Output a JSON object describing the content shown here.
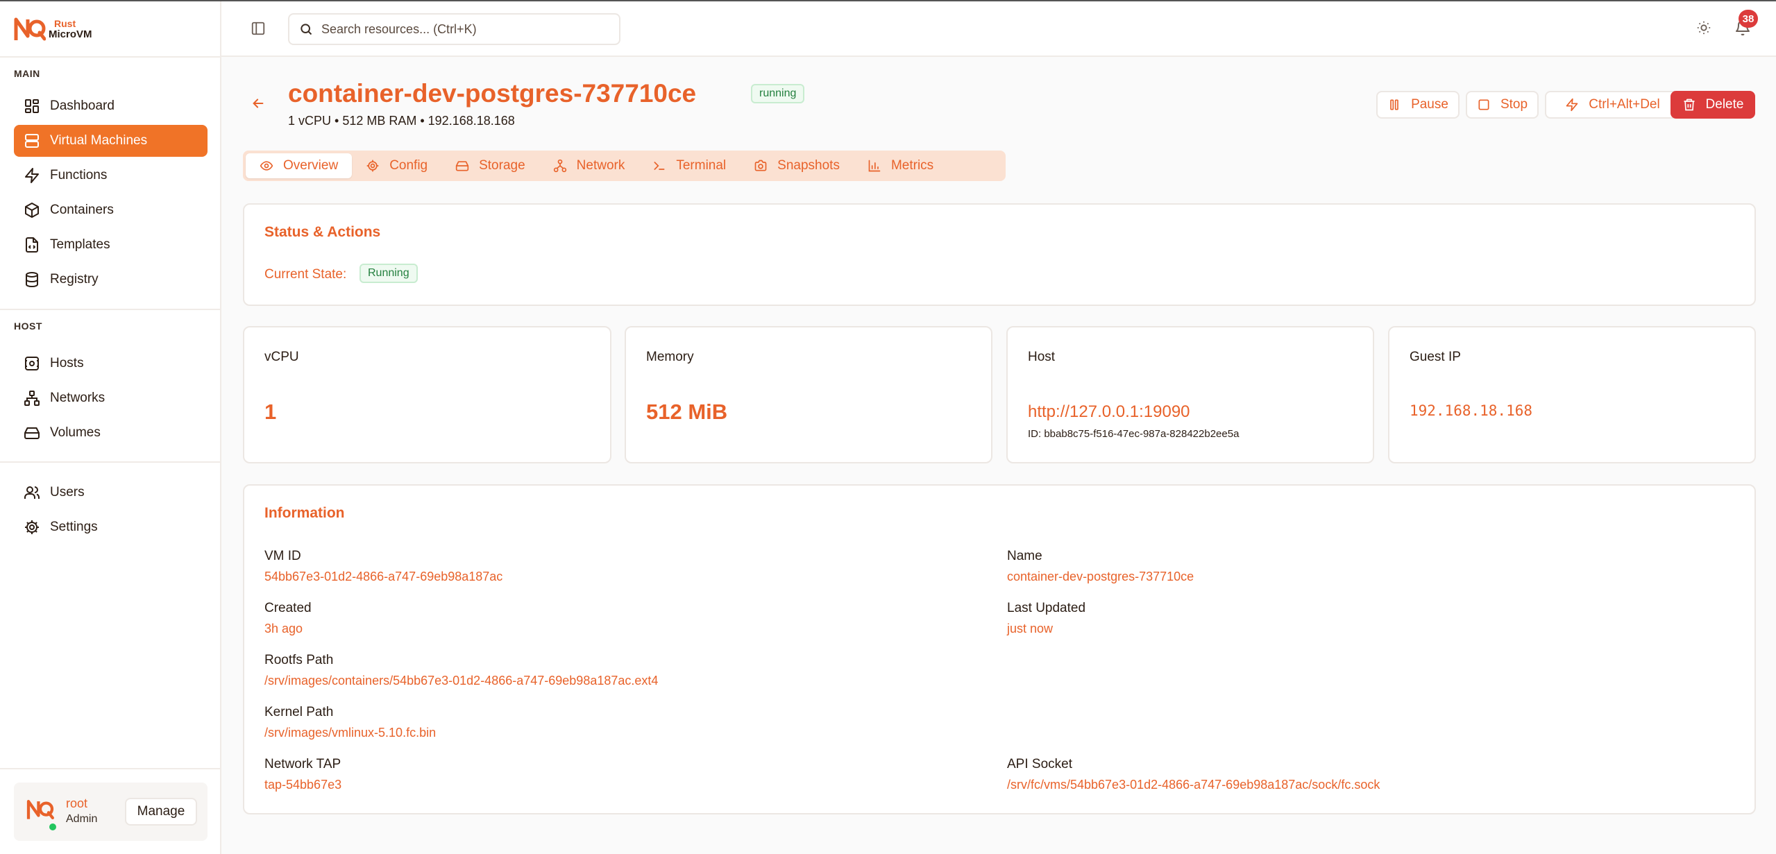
{
  "brand": {
    "line1": "Rust",
    "line2": "MicroVM",
    "logo_icon": "nq-logo-icon"
  },
  "sidebar": {
    "section_main": "MAIN",
    "section_host": "HOST",
    "main_items": [
      {
        "label": "Dashboard",
        "icon": "dashboard-icon"
      },
      {
        "label": "Virtual Machines",
        "icon": "server-icon"
      },
      {
        "label": "Functions",
        "icon": "bolt-icon"
      },
      {
        "label": "Containers",
        "icon": "box-icon"
      },
      {
        "label": "Templates",
        "icon": "file-code-icon"
      },
      {
        "label": "Registry",
        "icon": "database-icon"
      }
    ],
    "host_items": [
      {
        "label": "Hosts",
        "icon": "host-icon"
      },
      {
        "label": "Networks",
        "icon": "network-icon"
      },
      {
        "label": "Volumes",
        "icon": "hard-drive-icon"
      }
    ],
    "bottom_items": [
      {
        "label": "Users",
        "icon": "users-icon"
      },
      {
        "label": "Settings",
        "icon": "gear-icon"
      }
    ],
    "active_item": "Virtual Machines",
    "user": {
      "name": "root",
      "role": "Admin",
      "manage_label": "Manage",
      "online": true
    }
  },
  "topbar": {
    "search_placeholder": "Search resources... (Ctrl+K)",
    "notification_count": "38"
  },
  "vm": {
    "title": "container-dev-postgres-737710ce",
    "status": "running",
    "subtitle": "1 vCPU • 512 MB RAM • 192.168.18.168"
  },
  "actions": {
    "pause": "Pause",
    "stop": "Stop",
    "ctrl_alt_del": "Ctrl+Alt+Del",
    "delete": "Delete"
  },
  "tabs": [
    {
      "label": "Overview",
      "icon": "eye-icon",
      "active": true
    },
    {
      "label": "Config",
      "icon": "gear-icon",
      "active": false
    },
    {
      "label": "Storage",
      "icon": "hard-drive-icon",
      "active": false
    },
    {
      "label": "Network",
      "icon": "network-icon",
      "active": false
    },
    {
      "label": "Terminal",
      "icon": "terminal-icon",
      "active": false
    },
    {
      "label": "Snapshots",
      "icon": "camera-icon",
      "active": false
    },
    {
      "label": "Metrics",
      "icon": "bar-chart-icon",
      "active": false
    }
  ],
  "status_card": {
    "title": "Status & Actions",
    "state_label": "Current State:",
    "state_value": "Running"
  },
  "stats": {
    "vcpu": {
      "label": "vCPU",
      "value": "1"
    },
    "memory": {
      "label": "Memory",
      "value": "512 MiB"
    },
    "host": {
      "label": "Host",
      "value": "http://127.0.0.1:19090",
      "sub": "ID: bbab8c75-f516-47ec-987a-828422b2ee5a"
    },
    "guest_ip": {
      "label": "Guest IP",
      "value": "192.168.18.168"
    }
  },
  "information": {
    "title": "Information",
    "vm_id": {
      "label": "VM ID",
      "value": "54bb67e3-01d2-4866-a747-69eb98a187ac"
    },
    "name": {
      "label": "Name",
      "value": "container-dev-postgres-737710ce"
    },
    "created": {
      "label": "Created",
      "value": "3h ago"
    },
    "last_updated": {
      "label": "Last Updated",
      "value": "just now"
    },
    "rootfs_path": {
      "label": "Rootfs Path",
      "value": "/srv/images/containers/54bb67e3-01d2-4866-a747-69eb98a187ac.ext4"
    },
    "kernel_path": {
      "label": "Kernel Path",
      "value": "/srv/images/vmlinux-5.10.fc.bin"
    },
    "network_tap": {
      "label": "Network TAP",
      "value": "tap-54bb67e3"
    },
    "api_socket": {
      "label": "API Socket",
      "value": "/srv/fc/vms/54bb67e3-01d2-4866-a747-69eb98a187ac/sock/fc.sock"
    }
  },
  "colors": {
    "accent": "#e8622a",
    "active_nav_bg": "#f07327",
    "danger": "#dc3b3b",
    "success_text": "#24803f",
    "success_bg": "#effaf1"
  }
}
